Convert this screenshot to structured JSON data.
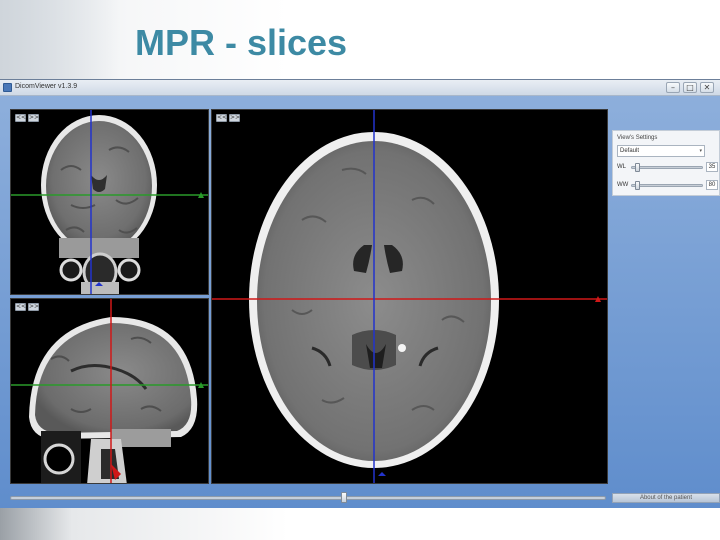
{
  "slide": {
    "title": "MPR - slices"
  },
  "app": {
    "title": "DicomViewer v1.3.9",
    "window_controls": {
      "minimize": "–",
      "maximize": "□",
      "close": "✕"
    }
  },
  "viewports": {
    "coronal": {
      "nav_prev": "<<",
      "nav_next": ">>"
    },
    "sagittal": {
      "nav_prev": "<<",
      "nav_next": ">>"
    },
    "axial": {
      "nav_prev": "<<",
      "nav_next": ">>"
    }
  },
  "settings": {
    "heading": "View's Settings",
    "preset": {
      "selected": "Default",
      "arrow": "▾"
    },
    "wl": {
      "label": "WL",
      "value": "35",
      "position": 0.05
    },
    "ww": {
      "label": "WW",
      "value": "80",
      "position": 0.05
    }
  },
  "slice_scroll": {
    "position": 0.56
  },
  "patient_button": {
    "label": "About of the patient"
  },
  "colors": {
    "title_color": "#3d8aa4",
    "crosshair_blue": "#2233cc",
    "crosshair_red": "#d01818",
    "crosshair_green": "#2a9a2a",
    "window_bg": "#6f98d2"
  }
}
